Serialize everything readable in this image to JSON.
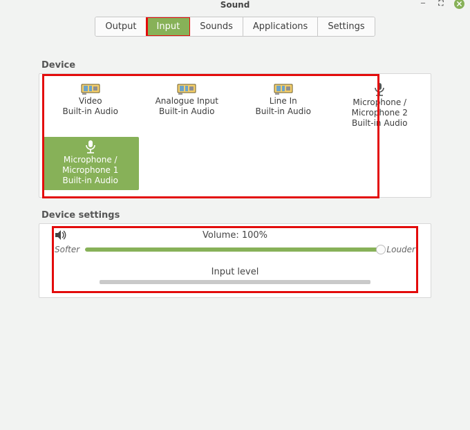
{
  "window": {
    "title": "Sound"
  },
  "tabs": [
    {
      "label": "Output",
      "active": false
    },
    {
      "label": "Input",
      "active": true
    },
    {
      "label": "Sounds",
      "active": false
    },
    {
      "label": "Applications",
      "active": false
    },
    {
      "label": "Settings",
      "active": false
    }
  ],
  "sections": {
    "device_heading": "Device",
    "device_settings_heading": "Device settings"
  },
  "devices": [
    {
      "label": "Video\nBuilt-in Audio",
      "icon": "card",
      "selected": false
    },
    {
      "label": "Analogue Input\nBuilt-in Audio",
      "icon": "card",
      "selected": false
    },
    {
      "label": "Line In\nBuilt-in Audio",
      "icon": "card",
      "selected": false
    },
    {
      "label": "Microphone /\nMicrophone 2\nBuilt-in Audio",
      "icon": "mic",
      "selected": false
    },
    {
      "label": "Microphone /\nMicrophone 1\nBuilt-in Audio",
      "icon": "mic",
      "selected": true
    }
  ],
  "settings": {
    "volume_label": "Volume: 100%",
    "volume_percent": 100,
    "softer_label": "Softer",
    "louder_label": "Louder",
    "input_level_label": "Input level"
  }
}
